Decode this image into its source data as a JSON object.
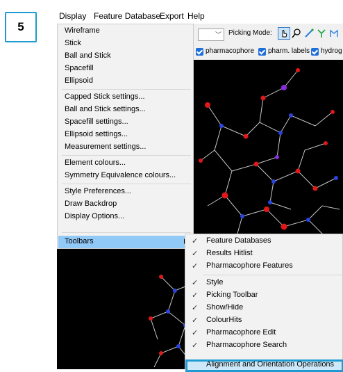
{
  "step": {
    "number": "5"
  },
  "menubar": [
    "Display",
    "Feature Database",
    "Export",
    "Help"
  ],
  "toolbar": {
    "picking_mode_label": "Picking Mode:",
    "picking_icons": [
      "hand-pointer-icon",
      "lasso-icon",
      "bond-select-icon",
      "fragment-select-icon",
      "molecule-select-icon"
    ]
  },
  "toggles": [
    "pharmacophore",
    "pharm. labels",
    "hydrog"
  ],
  "display_menu": {
    "items": [
      "Wireframe",
      "Stick",
      "Ball and Stick",
      "Spacefill",
      "Ellipsoid",
      "Capped Stick settings...",
      "Ball and Stick settings...",
      "Spacefill settings...",
      "Ellipsoid settings...",
      "Measurement settings...",
      "Element colours...",
      "Symmetry Equivalence colours...",
      "Style Preferences...",
      "Draw Backdrop",
      "Display Options...",
      "Toolbars"
    ]
  },
  "toolbars_submenu": {
    "items": [
      "Feature Databases",
      "Results Hitlist",
      "Pharmacophore Features",
      "Style",
      "Picking Toolbar",
      "Show/Hide",
      "ColourHits",
      "Pharmacophore Edit",
      "Pharmacophore Search",
      "Alignment and Orientation Operations"
    ],
    "check": "✓"
  },
  "colors": {
    "highlight": "#91c9f7",
    "focus_border": "#1f9bd1",
    "checkbox": "#1e6fd9"
  }
}
